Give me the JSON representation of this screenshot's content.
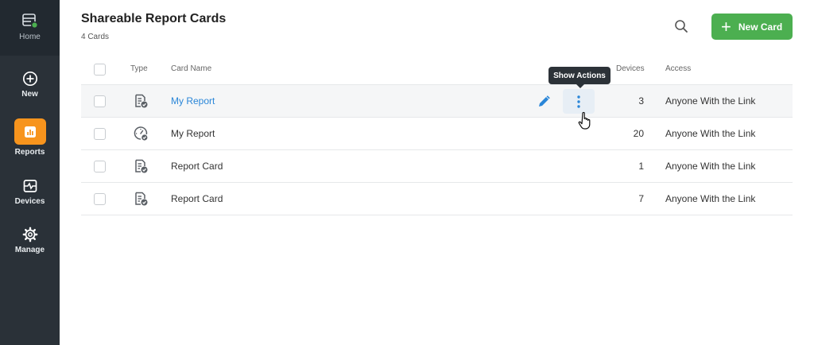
{
  "sidebar": {
    "home_label": "Home",
    "items": [
      {
        "label": "New",
        "icon": "plus-circle-icon"
      },
      {
        "label": "Reports",
        "icon": "bar-chart-icon"
      },
      {
        "label": "Devices",
        "icon": "devices-icon"
      },
      {
        "label": "Manage",
        "icon": "gear-icon"
      }
    ],
    "accent": "#f7941d"
  },
  "header": {
    "title": "Shareable Report Cards",
    "subtitle": "4 Cards",
    "new_card_label": "New Card",
    "new_card_color": "#4caf50"
  },
  "table": {
    "columns": {
      "type": "Type",
      "name": "Card Name",
      "devices": "Devices",
      "access": "Access"
    },
    "rows": [
      {
        "name": "My Report",
        "devices": "3",
        "access": "Anyone With the Link",
        "type_icon": "report-check-icon"
      },
      {
        "name": "My Report",
        "devices": "20",
        "access": "Anyone With the Link",
        "type_icon": "gauge-check-icon"
      },
      {
        "name": "Report Card",
        "devices": "1",
        "access": "Anyone With the Link",
        "type_icon": "report-check-icon"
      },
      {
        "name": "Report Card",
        "devices": "7",
        "access": "Anyone With the Link",
        "type_icon": "report-check-icon"
      }
    ]
  },
  "tooltip": {
    "text": "Show Actions"
  },
  "colors": {
    "link": "#2a86d8",
    "sidebar_bg": "#2a3138"
  }
}
